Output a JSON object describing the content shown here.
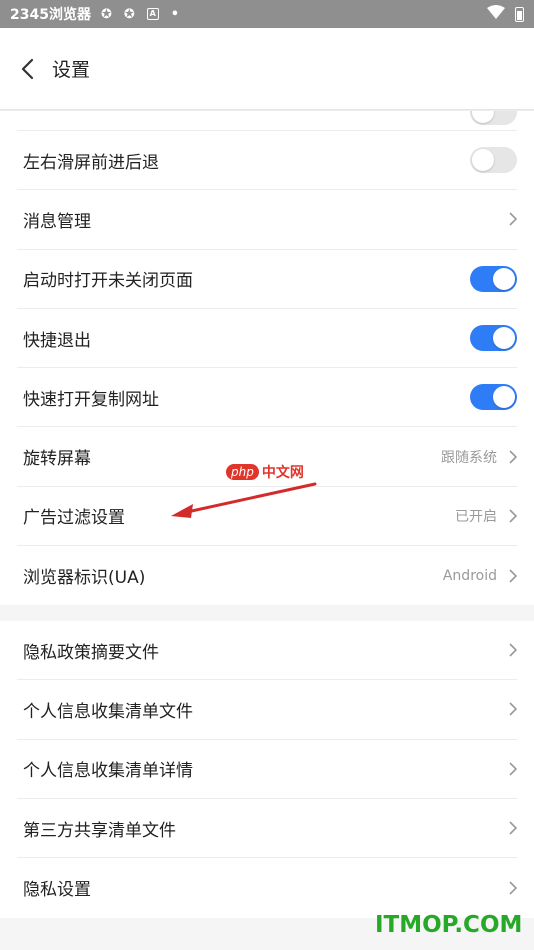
{
  "status_bar": {
    "app_name": "2345浏览器",
    "icons": [
      "chrome-icon",
      "chrome-icon",
      "a-box-icon",
      "dot-icon"
    ],
    "right_icons": [
      "wifi-icon",
      "battery-icon"
    ]
  },
  "header": {
    "title": "设置"
  },
  "group1": {
    "items": [
      {
        "label": "左右滑屏前进后退",
        "type": "toggle",
        "on": false
      },
      {
        "label": "消息管理",
        "type": "link",
        "value": ""
      },
      {
        "label": "启动时打开未关闭页面",
        "type": "toggle",
        "on": true
      },
      {
        "label": "快捷退出",
        "type": "toggle",
        "on": true
      },
      {
        "label": "快速打开复制网址",
        "type": "toggle",
        "on": true
      },
      {
        "label": "旋转屏幕",
        "type": "link",
        "value": "跟随系统"
      },
      {
        "label": "广告过滤设置",
        "type": "link",
        "value": "已开启"
      },
      {
        "label": "浏览器标识(UA)",
        "type": "link",
        "value": "Android"
      }
    ]
  },
  "group2": {
    "items": [
      {
        "label": "隐私政策摘要文件"
      },
      {
        "label": "个人信息收集清单文件"
      },
      {
        "label": "个人信息收集清单详情"
      },
      {
        "label": "第三方共享清单文件"
      },
      {
        "label": "隐私设置"
      }
    ]
  },
  "watermarks": {
    "php_badge": "php",
    "php_text": "中文网",
    "itmop": "ITMOP.COM"
  },
  "colors": {
    "toggle_on": "#2f7df6",
    "toggle_off": "#e6e6e6",
    "arrow": "#d32a2a",
    "itmop": "#28a828"
  }
}
